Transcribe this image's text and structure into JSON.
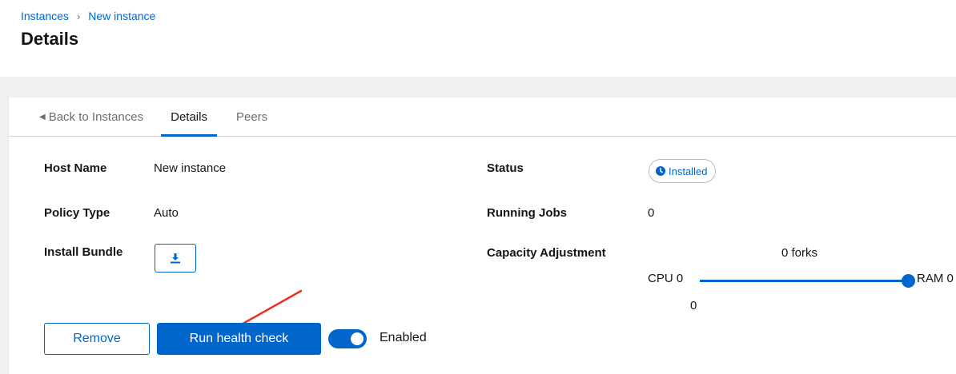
{
  "breadcrumb": {
    "items": [
      "Instances",
      "New instance"
    ],
    "separator": "›"
  },
  "page": {
    "title": "Details"
  },
  "tabs": [
    {
      "label": "Back to Instances",
      "icon": "caret-left-icon"
    },
    {
      "label": "Details",
      "active": true
    },
    {
      "label": "Peers"
    }
  ],
  "details": {
    "host_name": {
      "label": "Host Name",
      "value": "New instance"
    },
    "policy_type": {
      "label": "Policy Type",
      "value": "Auto"
    },
    "install_bundle": {
      "label": "Install Bundle",
      "icon": "download-icon"
    },
    "status": {
      "label": "Status",
      "value": "Installed",
      "icon": "clock-icon"
    },
    "running_jobs": {
      "label": "Running Jobs",
      "value": "0"
    },
    "capacity_adjustment": {
      "label": "Capacity Adjustment",
      "forks": "0 forks",
      "cpu_label": "CPU 0",
      "ram_label": "RAM 0",
      "slider_value": "0",
      "slider_fraction": 1.0
    }
  },
  "actions": {
    "remove_label": "Remove",
    "health_check_label": "Run health check",
    "enabled_label": "Enabled",
    "enabled": true
  },
  "colors": {
    "accent": "#0066cc",
    "annotation_arrow": "#e8321e",
    "page_bg": "#f0f0f0"
  }
}
